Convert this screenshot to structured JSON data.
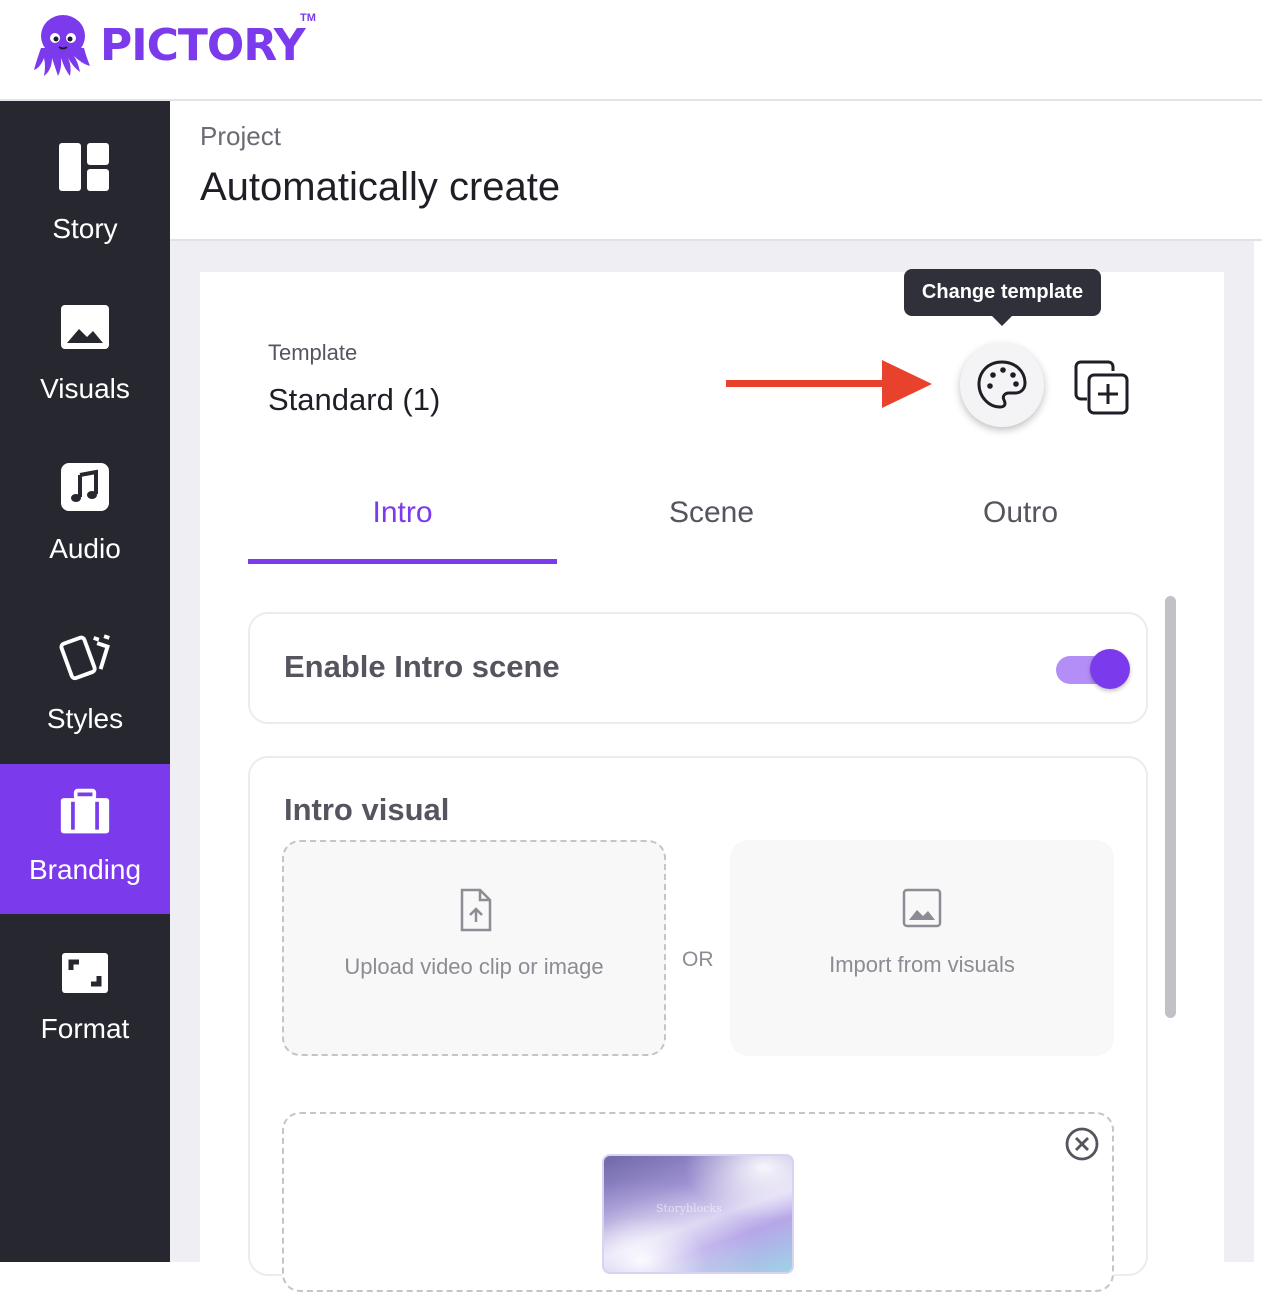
{
  "app": {
    "name": "PICTORY",
    "trademark": "TM",
    "brand_color": "#7c3aed",
    "logo_icon": "octopus-logo-icon"
  },
  "sidebar": {
    "items": [
      {
        "label": "Story",
        "icon": "story-layout-icon",
        "active": false
      },
      {
        "label": "Visuals",
        "icon": "image-icon",
        "active": false
      },
      {
        "label": "Audio",
        "icon": "music-note-icon",
        "active": false
      },
      {
        "label": "Styles",
        "icon": "cards-icon",
        "active": false
      },
      {
        "label": "Branding",
        "icon": "briefcase-icon",
        "active": true
      },
      {
        "label": "Format",
        "icon": "aspect-ratio-icon",
        "active": false
      }
    ]
  },
  "header": {
    "breadcrumb": "Project",
    "title": "Automatically create"
  },
  "template": {
    "label": "Template",
    "value": "Standard (1)",
    "tooltip": "Change template",
    "change_icon": "palette-icon",
    "duplicate_icon": "duplicate-add-icon"
  },
  "tabs": [
    {
      "label": "Intro",
      "active": true
    },
    {
      "label": "Scene",
      "active": false
    },
    {
      "label": "Outro",
      "active": false
    }
  ],
  "intro": {
    "enable_label": "Enable Intro scene",
    "enabled": true,
    "visual_title": "Intro visual",
    "upload_label": "Upload video clip or image",
    "or_label": "OR",
    "import_label": "Import from visuals",
    "thumbnail_text": "Storyblocks"
  }
}
